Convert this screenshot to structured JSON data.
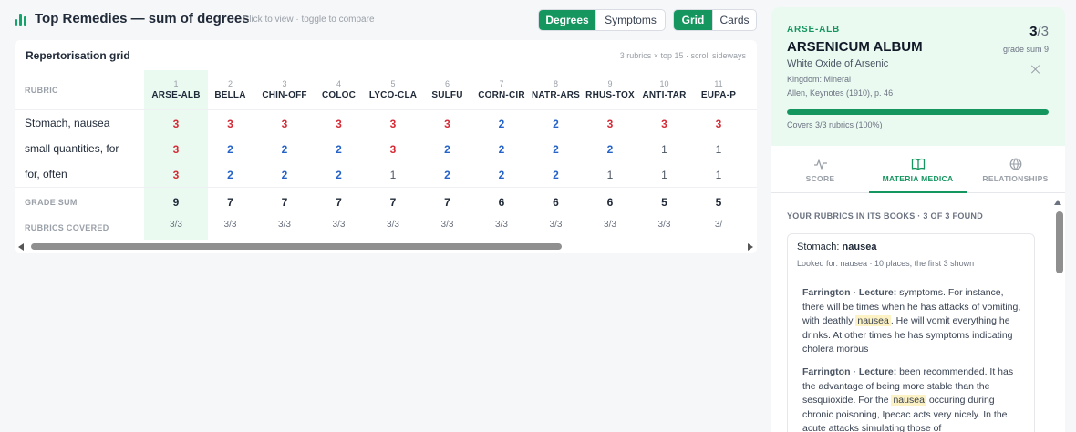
{
  "header": {
    "title": "Top Remedies — sum of degrees",
    "hint": "Click to view · toggle to compare",
    "mode_options": [
      "Degrees",
      "Symptoms"
    ],
    "mode_selected": "Degrees",
    "view_options": [
      "Grid",
      "Cards"
    ],
    "view_selected": "Grid"
  },
  "grid": {
    "title": "Repertorisation grid",
    "meta": "3 rubrics × top 15 · scroll sideways",
    "rubric_header": "RUBRIC",
    "rubrics": [
      "Stomach, nausea",
      "small quantities, for",
      "for, often"
    ],
    "footer_labels": [
      "GRADE SUM",
      "RUBRICS COVERED"
    ],
    "columns": [
      {
        "num": "1",
        "name": "ARSE-ALB",
        "grades": [
          "3",
          "3",
          "3"
        ],
        "sum": "9",
        "covered": "3/3"
      },
      {
        "num": "2",
        "name": "BELLA",
        "grades": [
          "3",
          "2",
          "2"
        ],
        "sum": "7",
        "covered": "3/3"
      },
      {
        "num": "3",
        "name": "CHIN-OFF",
        "grades": [
          "3",
          "2",
          "2"
        ],
        "sum": "7",
        "covered": "3/3"
      },
      {
        "num": "4",
        "name": "COLOC",
        "grades": [
          "3",
          "2",
          "2"
        ],
        "sum": "7",
        "covered": "3/3"
      },
      {
        "num": "5",
        "name": "LYCO-CLA",
        "grades": [
          "3",
          "3",
          "1"
        ],
        "sum": "7",
        "covered": "3/3"
      },
      {
        "num": "6",
        "name": "SULFU",
        "grades": [
          "3",
          "2",
          "2"
        ],
        "sum": "7",
        "covered": "3/3"
      },
      {
        "num": "7",
        "name": "CORN-CIR",
        "grades": [
          "2",
          "2",
          "2"
        ],
        "sum": "6",
        "covered": "3/3"
      },
      {
        "num": "8",
        "name": "NATR-ARS",
        "grades": [
          "2",
          "2",
          "2"
        ],
        "sum": "6",
        "covered": "3/3"
      },
      {
        "num": "9",
        "name": "RHUS-TOX",
        "grades": [
          "3",
          "2",
          "1"
        ],
        "sum": "6",
        "covered": "3/3"
      },
      {
        "num": "10",
        "name": "ANTI-TAR",
        "grades": [
          "3",
          "1",
          "1"
        ],
        "sum": "5",
        "covered": "3/3"
      },
      {
        "num": "11",
        "name": "EUPA-P",
        "grades": [
          "3",
          "1",
          "1"
        ],
        "sum": "5",
        "covered": "3/"
      }
    ]
  },
  "detail": {
    "abbr": "ARSE-ALB",
    "name": "ARSENICUM ALBUM",
    "subtitle": "White Oxide of Arsenic",
    "kingdom": "Kingdom: Mineral",
    "source": "Allen, Keynotes (1910), p. 46",
    "score": "3",
    "score_total": "/3",
    "grade_sum": "grade sum 9",
    "coverage_fraction": 1.0,
    "covers_text": "Covers 3/3 rubrics (100%)",
    "tabs": [
      {
        "label": "SCORE",
        "icon": "pulse-icon"
      },
      {
        "label": "MATERIA MEDICA",
        "icon": "book-icon"
      },
      {
        "label": "RELATIONSHIPS",
        "icon": "globe-icon"
      }
    ],
    "active_tab": "MATERIA MEDICA",
    "section_title": "YOUR RUBRICS IN ITS BOOKS · 3 OF 3 FOUND",
    "card": {
      "rubric_prefix": "Stomach: ",
      "rubric_term": "nausea",
      "looked_for": "Looked for: nausea · 10 places, the first 3 shown",
      "quotes": [
        {
          "who": "Farrington · Lecture:",
          "before": " symptoms. For instance, there will be times when he has attacks of vomiting, with deathly ",
          "mark": "nausea",
          "after": ". He will vomit everything he drinks. At other times he has symptoms indicating cholera morbus"
        },
        {
          "who": "Farrington · Lecture:",
          "before": " been recommended. It has the advantage of being more stable than the sesquioxide. For the ",
          "mark": "nausea",
          "after": " occuring during chronic poisoning, Ipecac acts very nicely. In the acute attacks simulating those of"
        }
      ]
    }
  },
  "colors": {
    "accent": "#15965f",
    "grade3": "#d62b36",
    "grade2": "#2563c9",
    "grade1": "#4b5563",
    "highlight": "#eafaf1"
  }
}
